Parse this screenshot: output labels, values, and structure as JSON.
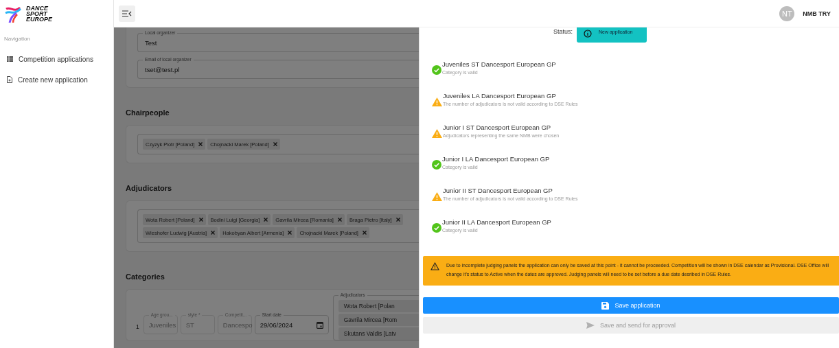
{
  "sidebar": {
    "logo": [
      "DANCE",
      "SPORT",
      "EUROPE"
    ],
    "section_label": "Navigation",
    "items": [
      {
        "label": "Competition applications",
        "kind": "list",
        "selected": false
      },
      {
        "label": "Create new application",
        "kind": "new-file",
        "selected": false
      }
    ]
  },
  "topbar": {
    "user_initials": "NT",
    "user_name": "NMB TRY"
  },
  "form": {
    "organizer_fields": [
      {
        "label": "Local organizer",
        "value": "Test"
      },
      {
        "label": "Email of local organizer",
        "value": "tset@test.pl"
      }
    ],
    "chairpeople": {
      "title": "Chairpeople",
      "people": [
        "Czyzyk Piotr [Poland]",
        "Chojnacki Marek [Poland]"
      ]
    },
    "adjudicators": {
      "title": "Adjudicators",
      "people": [
        "Wota Robert [Poland]",
        "Bodini Luigi [Georgia]",
        "Gavrila Mircea [Romania]",
        "Braga Pietro [Italy]",
        "Wieshofer Ludwig [Austria]",
        "Hakobyan Albert [Armenia]",
        "Chojnacki Marek [Poland]"
      ]
    },
    "categories": {
      "title": "Categories",
      "rows": [
        {
          "number": "1",
          "fields": [
            {
              "label": "Age grou...",
              "value": "Juveniles",
              "disabled": true
            },
            {
              "label": "style *",
              "value": "ST",
              "disabled": true
            },
            {
              "label": "Competit...",
              "value": "Dancespo",
              "disabled": true
            },
            {
              "label": "Start date",
              "value": "29/06/2024",
              "disabled": false
            }
          ],
          "adjudicators_label": "Adjudicators",
          "adjudicators": [
            "Wota Robert [Polan",
            "Gavrila Mircea [Rom",
            "Skutans Valdis [Latv"
          ]
        }
      ]
    }
  },
  "drawer": {
    "status_label": "Status:",
    "status": "New application",
    "checks": [
      {
        "title": "Juveniles ST Dancesport European GP",
        "message": "Category is valid",
        "kind": "valid"
      },
      {
        "title": "Juveniles LA Dancesport European GP",
        "message": "The number of adjudicators is not valid according to DSE Rules",
        "kind": "warning"
      },
      {
        "title": "Junior I ST Dancesport European GP",
        "message": "Adjudicators representing the same NMB were chosen",
        "kind": "warning"
      },
      {
        "title": "Junior I LA Dancesport European GP",
        "message": "Category is valid",
        "kind": "valid"
      },
      {
        "title": "Junior II ST Dancesport European GP",
        "message": "The number of adjudicators is not valid according to DSE Rules",
        "kind": "warning"
      },
      {
        "title": "Junior II LA Dancesport European GP",
        "message": "Category is valid",
        "kind": "valid"
      }
    ],
    "notice": "Due to incomplete judging panels the application can only be saved at this point - it cannot be proceeded. Competition will be shown in DSE calendar as Provisional. DSE Office will change it's status to Active when the dates are approved. Judging panels will need to be set before a due date desribed in DSE Rules.",
    "buttons": [
      {
        "label": "Save application",
        "kind": "save",
        "disabled": false
      },
      {
        "label": "Save and send for approval",
        "kind": "send",
        "disabled": true
      }
    ]
  }
}
